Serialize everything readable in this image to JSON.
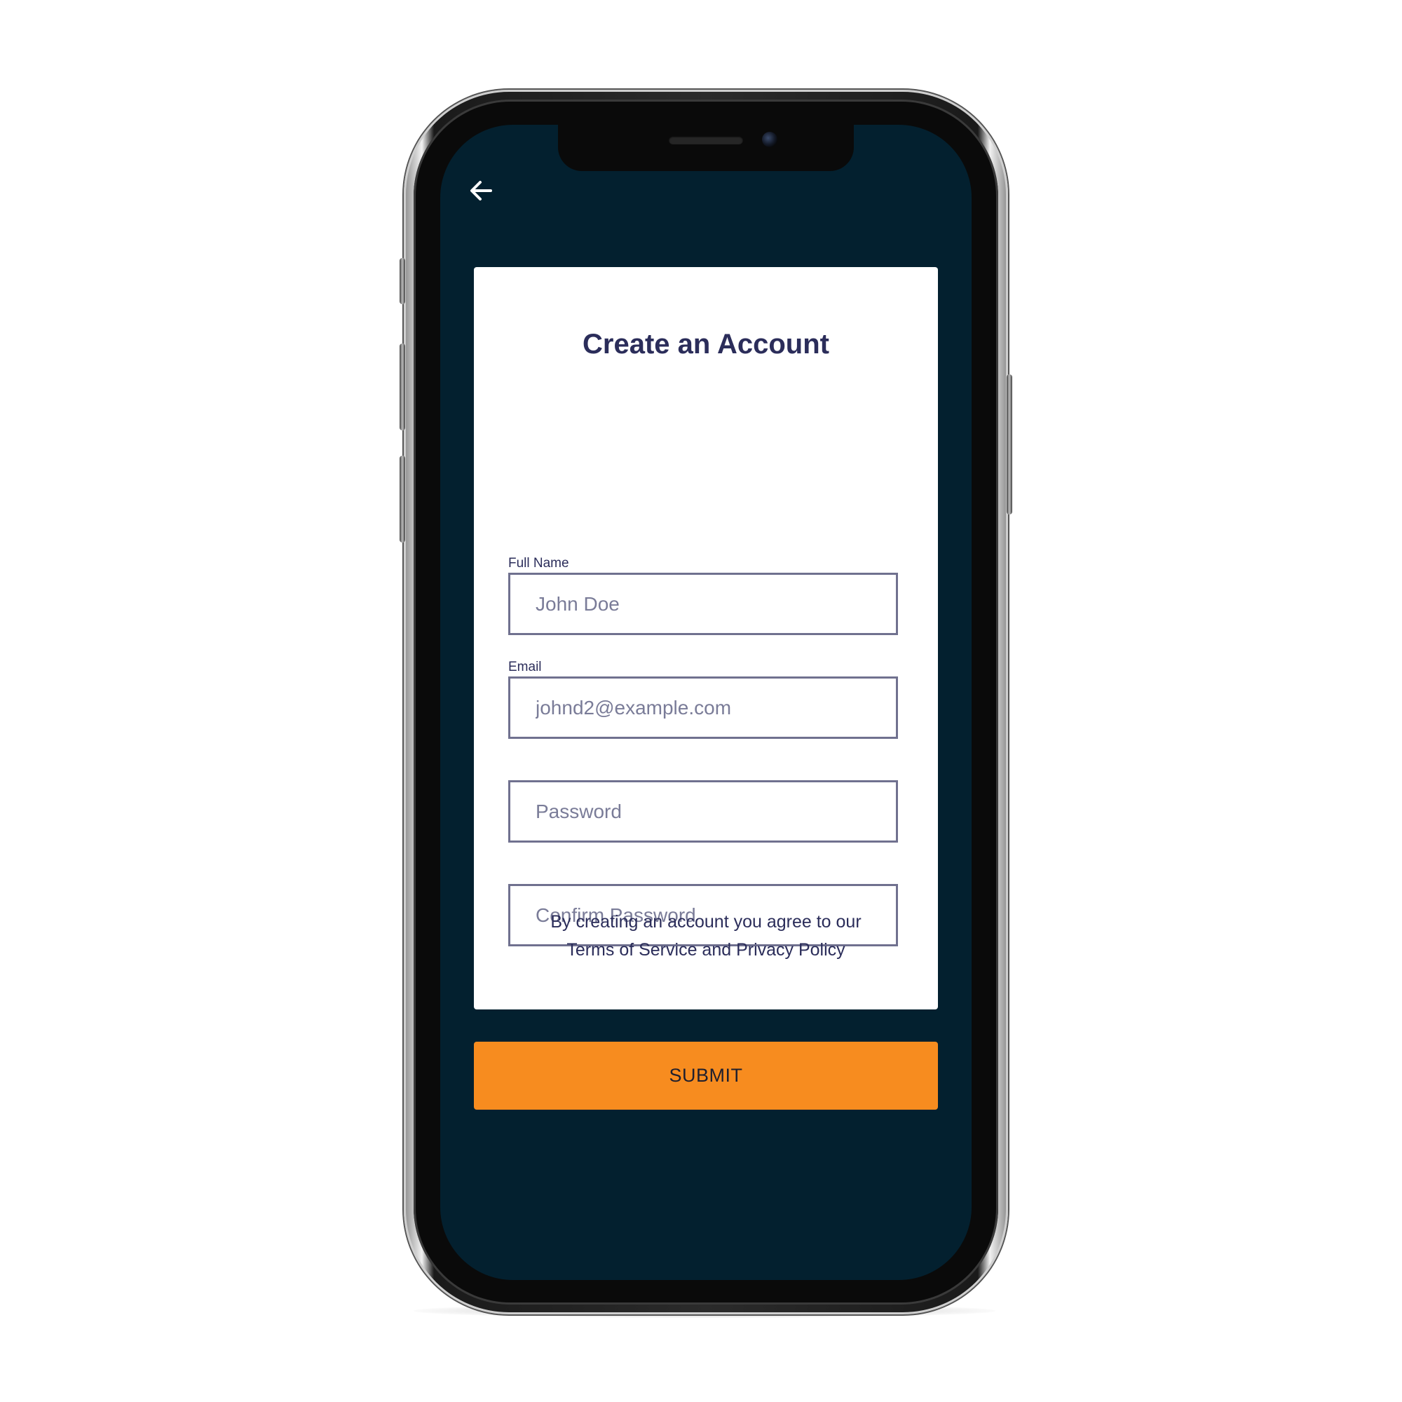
{
  "header": {
    "back_icon": "arrow-left-icon"
  },
  "form": {
    "title": "Create an Account",
    "full_name": {
      "label": "Full Name",
      "placeholder": "John Doe"
    },
    "email": {
      "label": "Email",
      "placeholder": "johnd2@example.com"
    },
    "password": {
      "placeholder": "Password"
    },
    "confirm_password": {
      "placeholder": "Confirm Password"
    },
    "terms_line_1": "By creating an account you agree to our",
    "terms_line_2": "Terms of Service and Privacy Policy"
  },
  "submit": {
    "label": "SUBMIT"
  },
  "colors": {
    "screen_background": "#03202f",
    "card_background": "#ffffff",
    "title_text": "#2b2d5a",
    "field_border": "#70718f",
    "submit_background": "#f78c1f"
  }
}
